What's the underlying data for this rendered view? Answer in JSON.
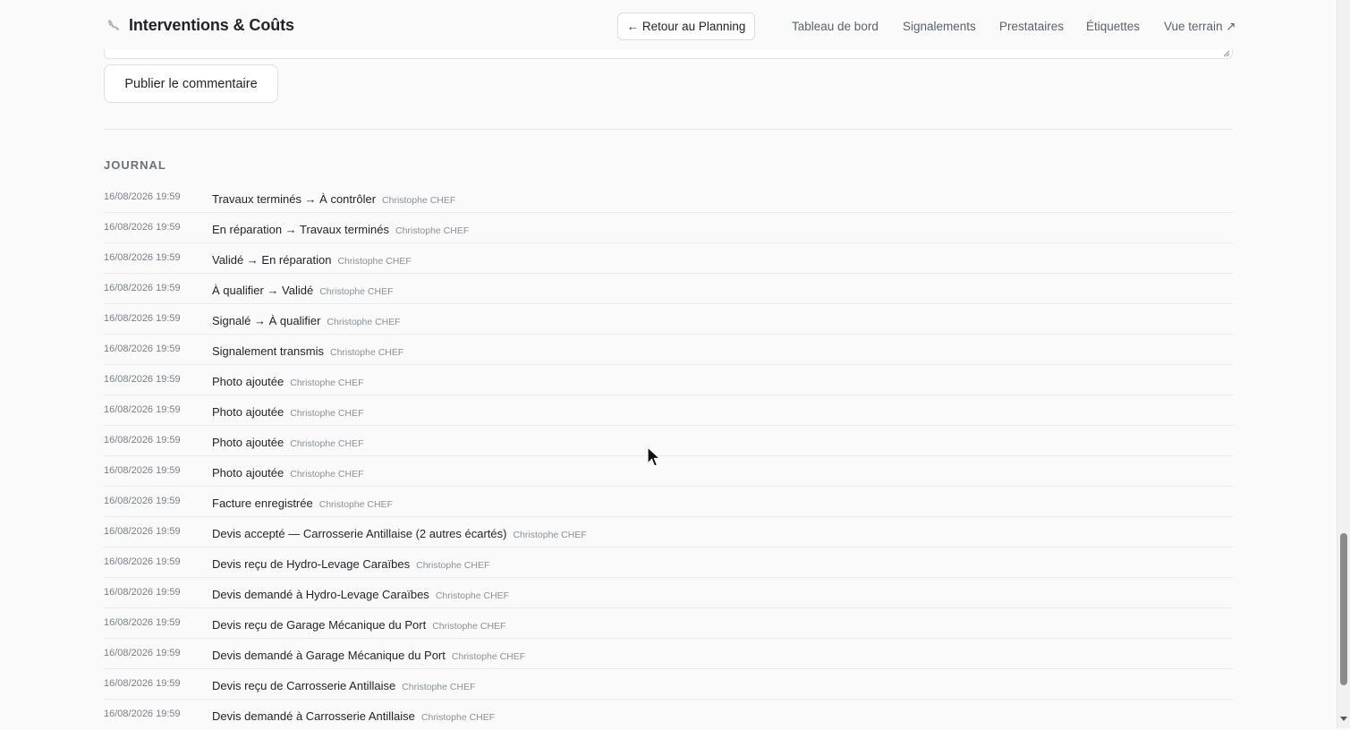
{
  "header": {
    "title": "Interventions & Coûts",
    "back_label": "← Retour au Planning",
    "nav": [
      {
        "label": "Tableau de bord"
      },
      {
        "label": "Signalements"
      },
      {
        "label": "Prestataires"
      },
      {
        "label": "Étiquettes"
      },
      {
        "label": "Vue terrain ↗"
      }
    ],
    "icon": "wrench-icon"
  },
  "comment": {
    "publish_label": "Publier le commentaire"
  },
  "journal": {
    "title": "JOURNAL",
    "entries": [
      {
        "date": "16/08/2026 19:59",
        "event": "Travaux terminés → À contrôler",
        "author": "Christophe CHEF"
      },
      {
        "date": "16/08/2026 19:59",
        "event": "En réparation → Travaux terminés",
        "author": "Christophe CHEF"
      },
      {
        "date": "16/08/2026 19:59",
        "event": "Validé → En réparation",
        "author": "Christophe CHEF"
      },
      {
        "date": "16/08/2026 19:59",
        "event": "À qualifier → Validé",
        "author": "Christophe CHEF"
      },
      {
        "date": "16/08/2026 19:59",
        "event": "Signalé → À qualifier",
        "author": "Christophe CHEF"
      },
      {
        "date": "16/08/2026 19:59",
        "event": "Signalement transmis",
        "author": "Christophe CHEF"
      },
      {
        "date": "16/08/2026 19:59",
        "event": "Photo ajoutée",
        "author": "Christophe CHEF"
      },
      {
        "date": "16/08/2026 19:59",
        "event": "Photo ajoutée",
        "author": "Christophe CHEF"
      },
      {
        "date": "16/08/2026 19:59",
        "event": "Photo ajoutée",
        "author": "Christophe CHEF"
      },
      {
        "date": "16/08/2026 19:59",
        "event": "Photo ajoutée",
        "author": "Christophe CHEF"
      },
      {
        "date": "16/08/2026 19:59",
        "event": "Facture enregistrée",
        "author": "Christophe CHEF"
      },
      {
        "date": "16/08/2026 19:59",
        "event": "Devis accepté — Carrosserie Antillaise (2 autres écartés)",
        "author": "Christophe CHEF"
      },
      {
        "date": "16/08/2026 19:59",
        "event": "Devis reçu de Hydro-Levage Caraïbes",
        "author": "Christophe CHEF"
      },
      {
        "date": "16/08/2026 19:59",
        "event": "Devis demandé à Hydro-Levage Caraïbes",
        "author": "Christophe CHEF"
      },
      {
        "date": "16/08/2026 19:59",
        "event": "Devis reçu de Garage Mécanique du Port",
        "author": "Christophe CHEF"
      },
      {
        "date": "16/08/2026 19:59",
        "event": "Devis demandé à Garage Mécanique du Port",
        "author": "Christophe CHEF"
      },
      {
        "date": "16/08/2026 19:59",
        "event": "Devis reçu de Carrosserie Antillaise",
        "author": "Christophe CHEF"
      },
      {
        "date": "16/08/2026 19:59",
        "event": "Devis demandé à Carrosserie Antillaise",
        "author": "Christophe CHEF"
      }
    ]
  }
}
